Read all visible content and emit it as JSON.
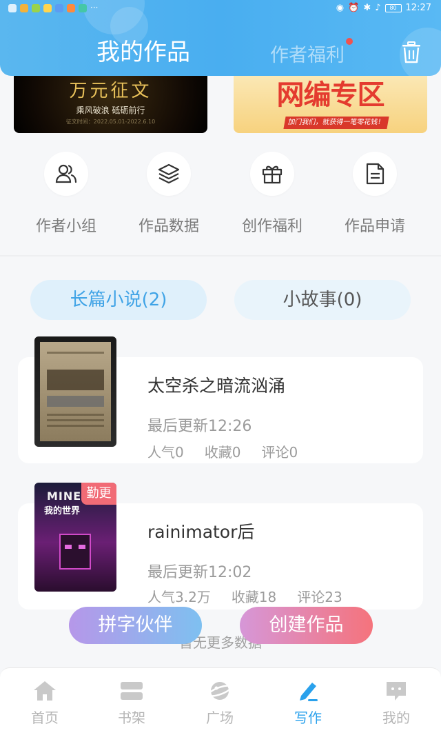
{
  "status_bar": {
    "time": "12:27",
    "battery": "80"
  },
  "header": {
    "title": "我的作品",
    "welfare_tab": "作者福利",
    "trash_icon": "trash-icon"
  },
  "banners": [
    {
      "title": "万元征文",
      "subtitle": "乘风破浪 砥砺前行",
      "date": "征文时间：2022.05.01-2022.6.10"
    },
    {
      "title": "网编专区",
      "strip": "加门我们，就获得一笔零花钱！"
    }
  ],
  "quick_actions": [
    {
      "label": "作者小组",
      "icon": "users-icon"
    },
    {
      "label": "作品数据",
      "icon": "layers-icon"
    },
    {
      "label": "创作福利",
      "icon": "gift-icon"
    },
    {
      "label": "作品申请",
      "icon": "document-icon"
    }
  ],
  "tabs": [
    {
      "label": "长篇小说(2)",
      "active": true
    },
    {
      "label": "小故事(0)",
      "active": false
    }
  ],
  "works": [
    {
      "title": "太空杀之暗流汹涌",
      "updated": "最后更新12:26",
      "popularity": "人气0",
      "favorites": "收藏0",
      "comments": "评论0",
      "badge": ""
    },
    {
      "title": "rainimator后",
      "updated": "最后更新12:02",
      "popularity": "人气3.2万",
      "favorites": "收藏18",
      "comments": "评论23",
      "badge": "勤更",
      "cover_text": "MINECRAFT",
      "cover_subtext": "我的世界"
    }
  ],
  "no_more_text": "暂无更多数据",
  "floating_buttons": [
    {
      "label": "拼字伙伴"
    },
    {
      "label": "创建作品"
    }
  ],
  "bottom_nav": [
    {
      "label": "首页",
      "icon": "home-icon",
      "active": false
    },
    {
      "label": "书架",
      "icon": "bookshelf-icon",
      "active": false
    },
    {
      "label": "广场",
      "icon": "planet-icon",
      "active": false
    },
    {
      "label": "写作",
      "icon": "pen-icon",
      "active": true
    },
    {
      "label": "我的",
      "icon": "profile-chat-icon",
      "active": false
    }
  ],
  "colors": {
    "accent": "#2aa1ec",
    "header": "#4fb3f0",
    "badge": "#f16b76"
  }
}
